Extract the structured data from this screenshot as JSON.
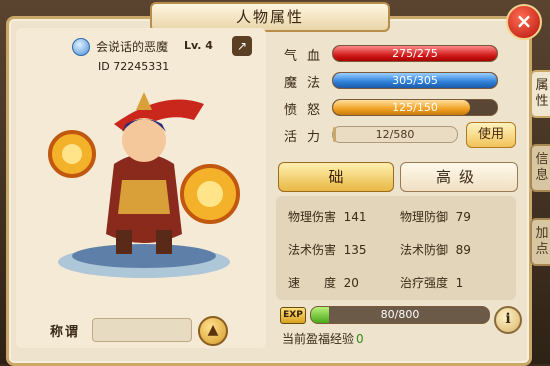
{
  "window": {
    "title": "人物属性",
    "close_symbol": "×"
  },
  "player": {
    "name": "会说话的恶魔",
    "level": "Lv. 4",
    "id": "ID 72245331"
  },
  "stats": {
    "hp": {
      "label": "气血",
      "value": "275/275",
      "fraction": 1.0
    },
    "mp": {
      "label": "魔法",
      "value": "305/305",
      "fraction": 1.0
    },
    "rage": {
      "label": "愤怒",
      "value": "125/150",
      "fraction": 0.833
    },
    "vigor": {
      "label": "活力",
      "value": "12/580",
      "fraction": 0.021
    }
  },
  "buttons": {
    "use": "使用",
    "basic": "础",
    "advanced": "高级"
  },
  "attributes": [
    {
      "label": "物理伤害",
      "value": "141"
    },
    {
      "label": "物理防御",
      "value": "79"
    },
    {
      "label": "法术伤害",
      "value": "135"
    },
    {
      "label": "法术防御",
      "value": "89"
    },
    {
      "label": "速　　度",
      "value": "20"
    },
    {
      "label": "治疗强度",
      "value": "1"
    }
  ],
  "exp": {
    "badge": "EXP",
    "value": "80/800",
    "fraction": 0.1
  },
  "blessing": {
    "label": "当前盈福经验",
    "value": "0"
  },
  "title_field": {
    "label": "称谓"
  },
  "side_tabs": [
    "属性",
    "信息",
    "加点"
  ],
  "colors": {
    "hp": "#d21e1e",
    "mp": "#2d7fd8",
    "rage": "#f0a020",
    "exp": "#4aa818"
  }
}
